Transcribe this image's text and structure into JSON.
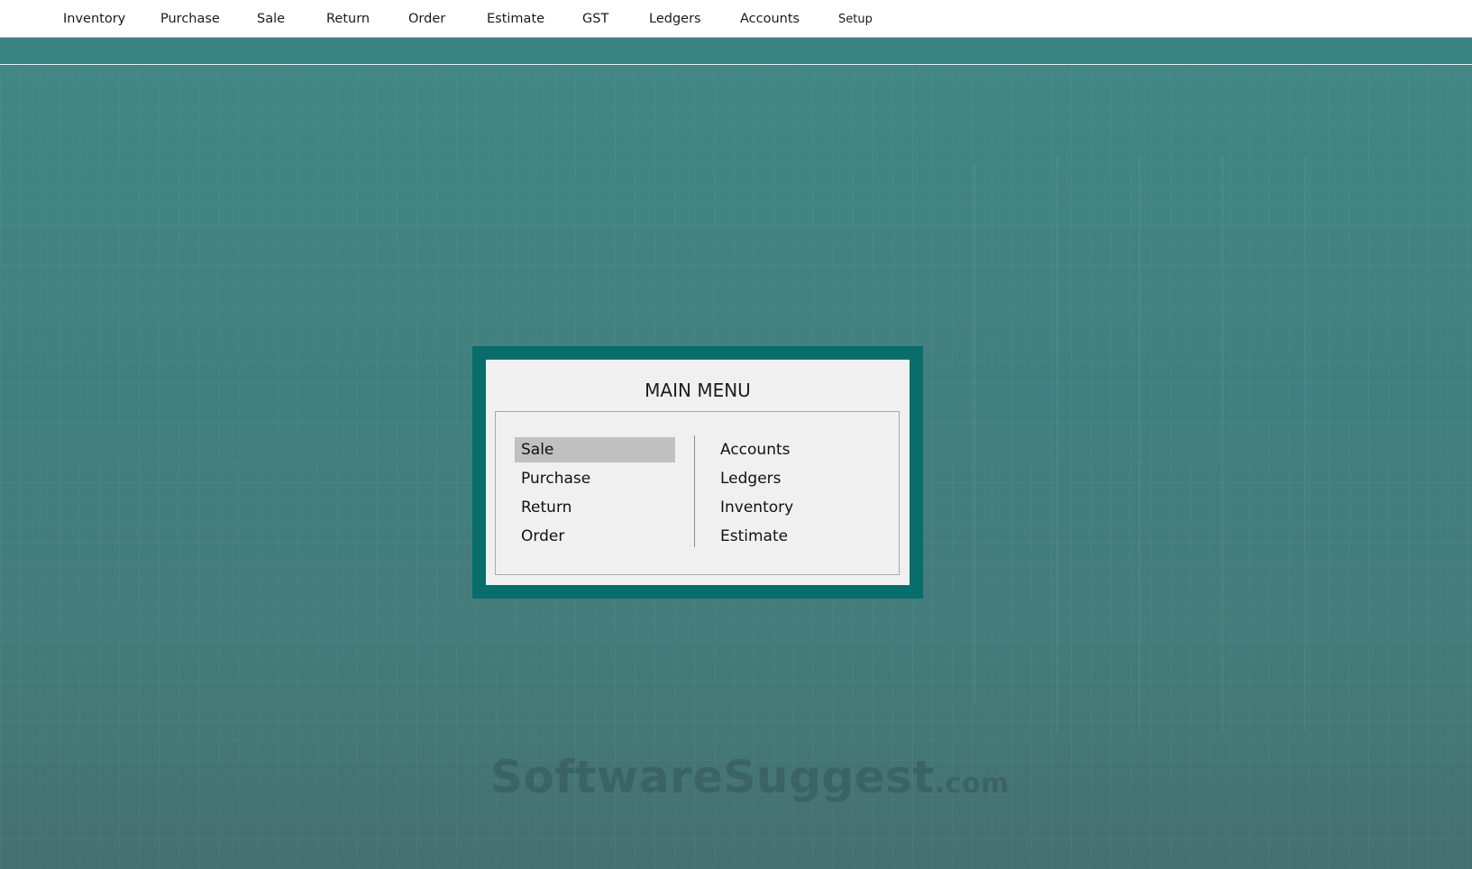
{
  "menubar": {
    "items": [
      {
        "label": "Inventory"
      },
      {
        "label": "Purchase"
      },
      {
        "label": "Sale"
      },
      {
        "label": "Return"
      },
      {
        "label": "Order"
      },
      {
        "label": "Estimate"
      },
      {
        "label": "GST"
      },
      {
        "label": "Ledgers"
      },
      {
        "label": "Accounts"
      },
      {
        "label": "Setup"
      }
    ]
  },
  "main_menu": {
    "title": "MAIN MENU",
    "left_column": [
      {
        "label": "Sale",
        "selected": true
      },
      {
        "label": "Purchase"
      },
      {
        "label": "Return"
      },
      {
        "label": "Order"
      }
    ],
    "right_column": [
      {
        "label": "Accounts"
      },
      {
        "label": "Ledgers"
      },
      {
        "label": "Inventory"
      },
      {
        "label": "Estimate"
      }
    ]
  },
  "watermark": {
    "text": "SoftwareSuggest",
    "suffix": ".com"
  },
  "colors": {
    "desktop": "#3f8080",
    "dialog_frame": "#086d6b",
    "dialog_bg": "#f0f0f0",
    "selection": "#c0c0c0"
  }
}
